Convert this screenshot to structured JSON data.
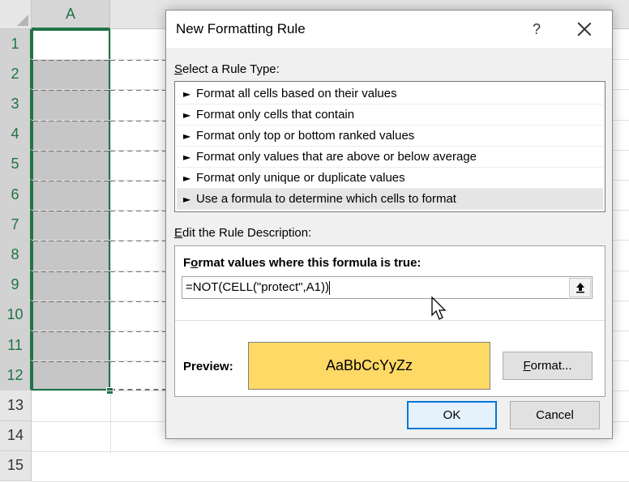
{
  "sheet": {
    "column_header": "A",
    "row_numbers": [
      "1",
      "2",
      "3",
      "4",
      "5",
      "6",
      "7",
      "8",
      "9",
      "10",
      "11",
      "12",
      "13",
      "14",
      "15"
    ]
  },
  "dialog": {
    "title": "New Formatting Rule",
    "help_glyph": "?",
    "select_rule_type_prefix": "S",
    "select_rule_type_rest": "elect a Rule Type:",
    "rule_types": [
      "Format all cells based on their values",
      "Format only cells that contain",
      "Format only top or bottom ranked values",
      "Format only values that are above or below average",
      "Format only unique or duplicate values",
      "Use a formula to determine which cells to format"
    ],
    "selected_rule_index": 5,
    "edit_description_prefix": "E",
    "edit_description_rest": "dit the Rule Description:",
    "formula_label_a": "F",
    "formula_label_u": "o",
    "formula_label_b": "rmat values where this formula is true:",
    "formula_value": "=NOT(CELL(\"protect\",A1))",
    "preview_label": "Preview:",
    "preview_sample": "AaBbCcYyZz",
    "preview_fill_color": "#ffd966",
    "format_button_u": "F",
    "format_button_rest": "ormat...",
    "ok_label": "OK",
    "cancel_label": "Cancel"
  }
}
